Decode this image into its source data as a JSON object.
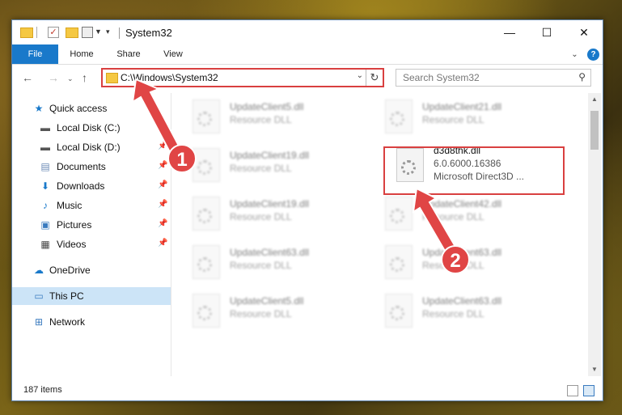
{
  "window": {
    "title": "System32"
  },
  "controls": {
    "minimize": "—",
    "maximize": "☐",
    "close": "✕"
  },
  "ribbon": {
    "tabs": [
      "File",
      "Home",
      "Share",
      "View"
    ],
    "help": "?"
  },
  "nav": {
    "address": "C:\\Windows\\System32",
    "search_placeholder": "Search System32"
  },
  "sidebar": {
    "items": [
      {
        "label": "Quick access",
        "icon": "star-icon"
      },
      {
        "label": "Local Disk (C:)",
        "icon": "drive-icon"
      },
      {
        "label": "Local Disk (D:)",
        "icon": "drive-icon"
      },
      {
        "label": "Documents",
        "icon": "documents-icon"
      },
      {
        "label": "Downloads",
        "icon": "download-icon"
      },
      {
        "label": "Music",
        "icon": "music-icon"
      },
      {
        "label": "Pictures",
        "icon": "pictures-icon"
      },
      {
        "label": "Videos",
        "icon": "videos-icon"
      },
      {
        "label": "OneDrive",
        "icon": "cloud-icon"
      },
      {
        "label": "This PC",
        "icon": "computer-icon"
      },
      {
        "label": "Network",
        "icon": "network-icon"
      }
    ]
  },
  "files": {
    "left": [
      {
        "name": "UpdateClient5.dll",
        "type": "Resource DLL"
      },
      {
        "name": "UpdateClient19.dll",
        "type": "Resource DLL"
      },
      {
        "name": "UpdateClient19.dll",
        "type": "Resource DLL"
      },
      {
        "name": "UpdateClient63.dll",
        "type": "Resource DLL"
      },
      {
        "name": "UpdateClient5.dll",
        "type": "Resource DLL"
      }
    ],
    "right": [
      {
        "name": "UpdateClient21.dll",
        "type": "Resource DLL"
      },
      {
        "name": "d3d8thk.dll",
        "version": "6.0.6000.16386",
        "type": "Microsoft Direct3D ..."
      },
      {
        "name": "UpdateClient42.dll",
        "type": "Resource DLL"
      },
      {
        "name": "UpdateClient63.dll",
        "type": "Resource DLL"
      },
      {
        "name": "UpdateClient63.dll",
        "type": "Resource DLL"
      }
    ]
  },
  "annotations": {
    "step1": "1",
    "step2": "2",
    "arrow_color": "#e04545"
  },
  "status": {
    "count": "187 items"
  }
}
